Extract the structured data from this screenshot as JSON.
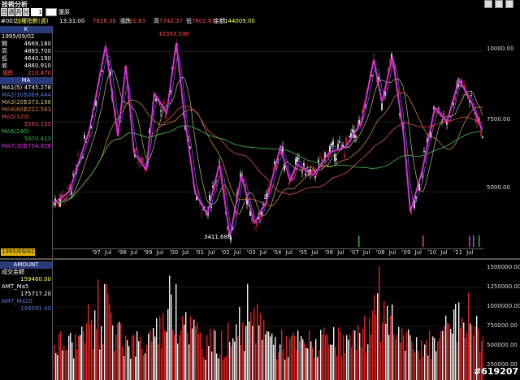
{
  "window": {
    "title": "技術分析"
  },
  "toolbar": {
    "tabs": [
      "日",
      "週",
      "月",
      "分"
    ],
    "period_value": "1",
    "reset_label": "還原"
  },
  "info": {
    "code": "#001",
    "name": "加權指數(週)",
    "time": "13:31:00",
    "price": "7616.36",
    "change_label": "漲跌",
    "change": "91.83",
    "high_label": "高",
    "high": "7742.37",
    "low_label": "低",
    "low": "7602.83",
    "amount_label": "金額",
    "amount": "144009.00"
  },
  "kpanel": {
    "title": "K",
    "date": "1995/09/02",
    "rows": [
      {
        "k": "開",
        "v": "4669.180"
      },
      {
        "k": "高",
        "v": "4865.700"
      },
      {
        "k": "低",
        "v": "4640.190"
      },
      {
        "k": "收",
        "v": "4860.910"
      },
      {
        "k": "漲跌",
        "v": "210.470"
      }
    ]
  },
  "mapanel": {
    "title": "MA",
    "rows": [
      {
        "k": "MA1(5)",
        "v": "4745.278"
      },
      {
        "k": "MA2(10)",
        "v": "5069.444"
      },
      {
        "k": "MA3(20)",
        "v": "5373.198"
      },
      {
        "k": "MA4(60)",
        "v": "6222.563"
      },
      {
        "k": "MA5(120)",
        "v": ""
      },
      {
        "k": "",
        "v": "5580.155"
      },
      {
        "k": "MA6(240)",
        "v": ""
      },
      {
        "k": "",
        "v": "5070.413"
      },
      {
        "k": "MA7(30)",
        "v": "5754.858"
      }
    ]
  },
  "amtpanel": {
    "title": "AMOUNT",
    "rows": [
      {
        "k": "成交金額",
        "v": ""
      },
      {
        "k": "",
        "v": "159460.00"
      },
      {
        "k": "AMT_Ma5",
        "v": ""
      },
      {
        "k": "",
        "v": "175717.20"
      },
      {
        "k": "AMT_Ma10",
        "v": ""
      },
      {
        "k": "",
        "v": "194091.40"
      }
    ]
  },
  "price_axis": [
    "10000.00",
    "7500.00",
    "5000.00"
  ],
  "vol_axis": [
    "1500000.00",
    "1250000.00",
    "1000000.00",
    "750000.00",
    "500000.00",
    "250000.00"
  ],
  "date_box": "1995/09/02",
  "years": [
    "'97",
    "Jul",
    "'98",
    "Jul",
    "'99",
    "Jul",
    "'00",
    "Jul",
    "'01",
    "Jul",
    "'02",
    "Jul",
    "'03",
    "Jul",
    "'04",
    "Jul",
    "'05",
    "Jul",
    "'06",
    "Jul",
    "'07",
    "Jul",
    "'08",
    "Jul",
    "'09",
    "Jul",
    "'10",
    "Jul",
    "'11",
    "Jul"
  ],
  "annotations": {
    "high": "10393.590",
    "low": "3411.680"
  },
  "watermark": "#619207",
  "colors": {
    "up": "#ffffff",
    "down": "#e02020",
    "ma_magenta": "#e030e0",
    "ma_green": "#3cb043",
    "ma_orange": "#d08030",
    "ma_blue": "#5b7bd8",
    "header_bg": "#2b3a7a"
  }
}
